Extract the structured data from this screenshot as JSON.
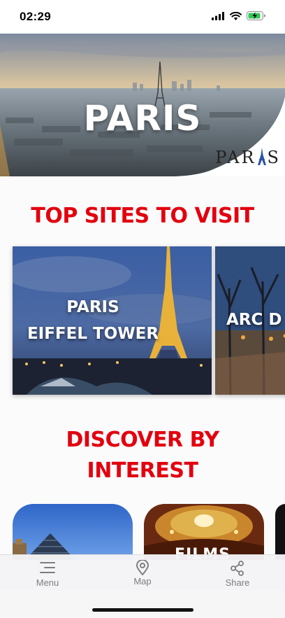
{
  "status_bar": {
    "time": "02:29",
    "icons": [
      "signal-icon",
      "wifi-icon",
      "battery-charging-icon"
    ]
  },
  "hero": {
    "title": "PARIS",
    "logo_text_1": "PAR",
    "logo_text_2": "S"
  },
  "top_sites": {
    "title": "TOP SITES TO VISIT",
    "cards": [
      {
        "line1": "PARIS",
        "line2": "EIFFEL TOWER"
      },
      {
        "line1": "ARC D"
      }
    ]
  },
  "discover": {
    "line1": "DISCOVER BY",
    "line2": "INTEREST",
    "cards": [
      {
        "label": ""
      },
      {
        "label": "FILMS"
      }
    ]
  },
  "tab_bar": {
    "items": [
      {
        "label": "Menu",
        "icon": "menu-icon"
      },
      {
        "label": "Map",
        "icon": "map-pin-icon"
      },
      {
        "label": "Share",
        "icon": "share-icon"
      }
    ]
  },
  "colors": {
    "accent": "#e3000f",
    "tab_label": "#7d7d80"
  }
}
